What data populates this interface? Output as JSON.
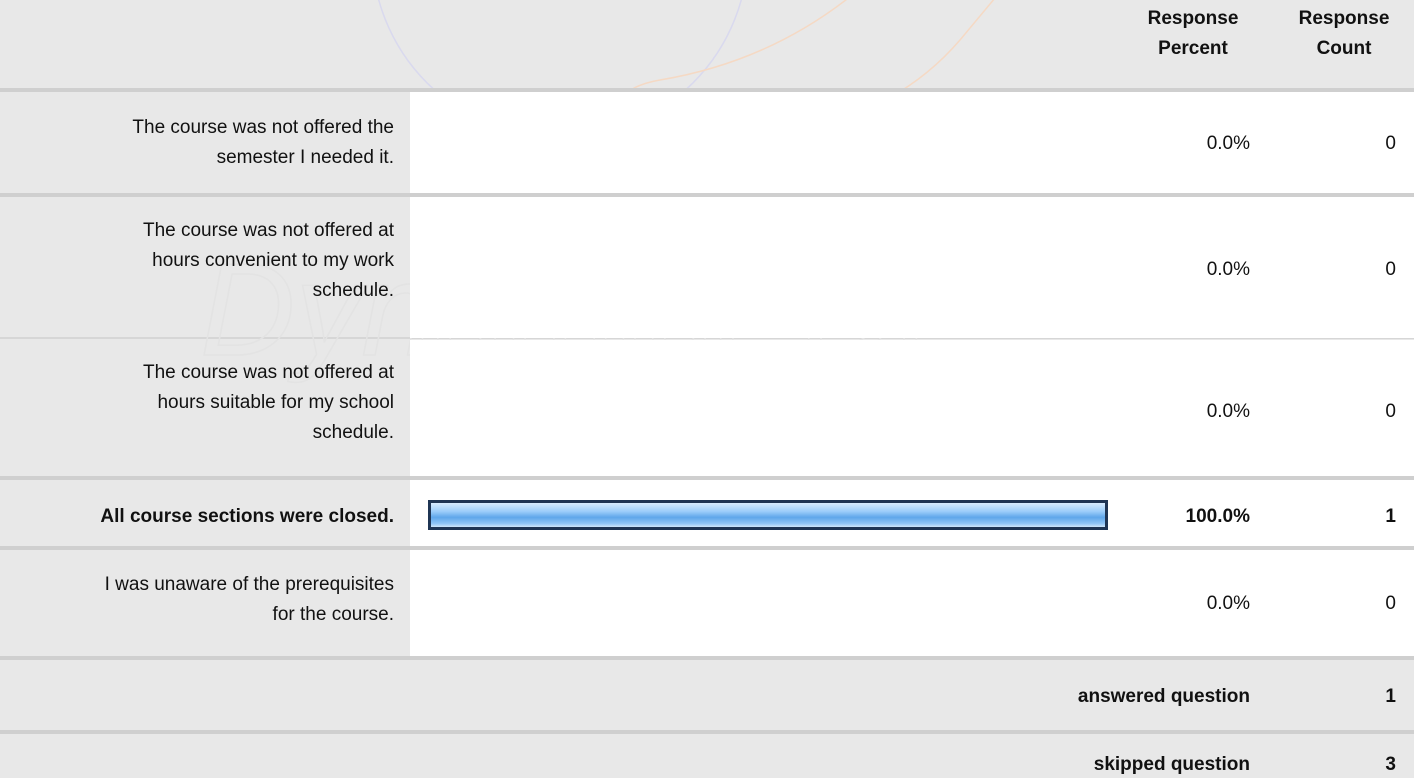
{
  "header": {
    "col_percent_line1": "Response",
    "col_percent_line2": "Percent",
    "col_count_line1": "Response",
    "col_count_line2": "Count"
  },
  "rows": [
    {
      "label_lines": [
        "The course was not offered the",
        "semester I needed it."
      ],
      "percent": "0.0%",
      "count": "0",
      "bar_fraction": 0
    },
    {
      "label_lines": [
        "The course was not offered at",
        "hours convenient to my work",
        "schedule."
      ],
      "percent": "0.0%",
      "count": "0",
      "bar_fraction": 0
    },
    {
      "label_lines": [
        "The course was not offered at",
        "hours suitable for my school",
        "schedule."
      ],
      "percent": "0.0%",
      "count": "0",
      "bar_fraction": 0
    },
    {
      "label_lines": [
        "All course sections were closed."
      ],
      "percent": "100.0%",
      "count": "1",
      "bar_fraction": 1.0
    },
    {
      "label_lines": [
        "I was unaware of the prerequisites",
        "for the course."
      ],
      "percent": "0.0%",
      "count": "0",
      "bar_fraction": 0
    }
  ],
  "summary": {
    "answered_label": "answered question",
    "answered_count": "1",
    "skipped_label": "skipped question",
    "skipped_count": "3"
  },
  "watermark": {
    "text": "DynamicPDF"
  },
  "colors": {
    "background": "#e8e8e8",
    "white": "#ffffff",
    "separator": "#cfcfcf",
    "bar_border": "#1f3554",
    "bar_fill": "#5fa6ea"
  }
}
